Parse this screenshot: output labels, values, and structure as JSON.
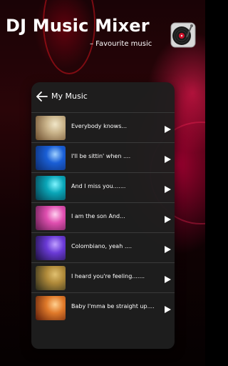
{
  "header": {
    "title": "DJ Music Mixer",
    "subtitle": "– Favourite music",
    "logo_icon": "turntable-icon"
  },
  "panel": {
    "title": "My Music",
    "back_icon": "arrow-left-icon"
  },
  "songs": [
    {
      "title": "Everybody knows...",
      "thumb_colors": [
        "#c9b38a",
        "#6a4a2a",
        "#f0e6c8"
      ]
    },
    {
      "title": "I'll be sittin' when ....",
      "thumb_colors": [
        "#1a5fd6",
        "#0c2a6a",
        "#9fd0ff"
      ]
    },
    {
      "title": "And I miss you.......",
      "thumb_colors": [
        "#0aa6b8",
        "#063a4a",
        "#7ff4ff"
      ]
    },
    {
      "title": "I am the son And...",
      "thumb_colors": [
        "#e04fb0",
        "#5a1a4a",
        "#ffd0f0"
      ]
    },
    {
      "title": "Colombiano, yeah ....",
      "thumb_colors": [
        "#6a3ad6",
        "#1a0f3a",
        "#c0a0ff"
      ]
    },
    {
      "title": "I heard you're feeling.......",
      "thumb_colors": [
        "#b08a3a",
        "#2a2a1a",
        "#e0c070"
      ]
    },
    {
      "title": "Baby I'mma be straight up....",
      "thumb_colors": [
        "#e07a2a",
        "#5a1a08",
        "#ffd090"
      ]
    }
  ],
  "colors": {
    "panel_bg": "#1e1e1e",
    "accent": "#e0142a",
    "text": "#ffffff"
  }
}
